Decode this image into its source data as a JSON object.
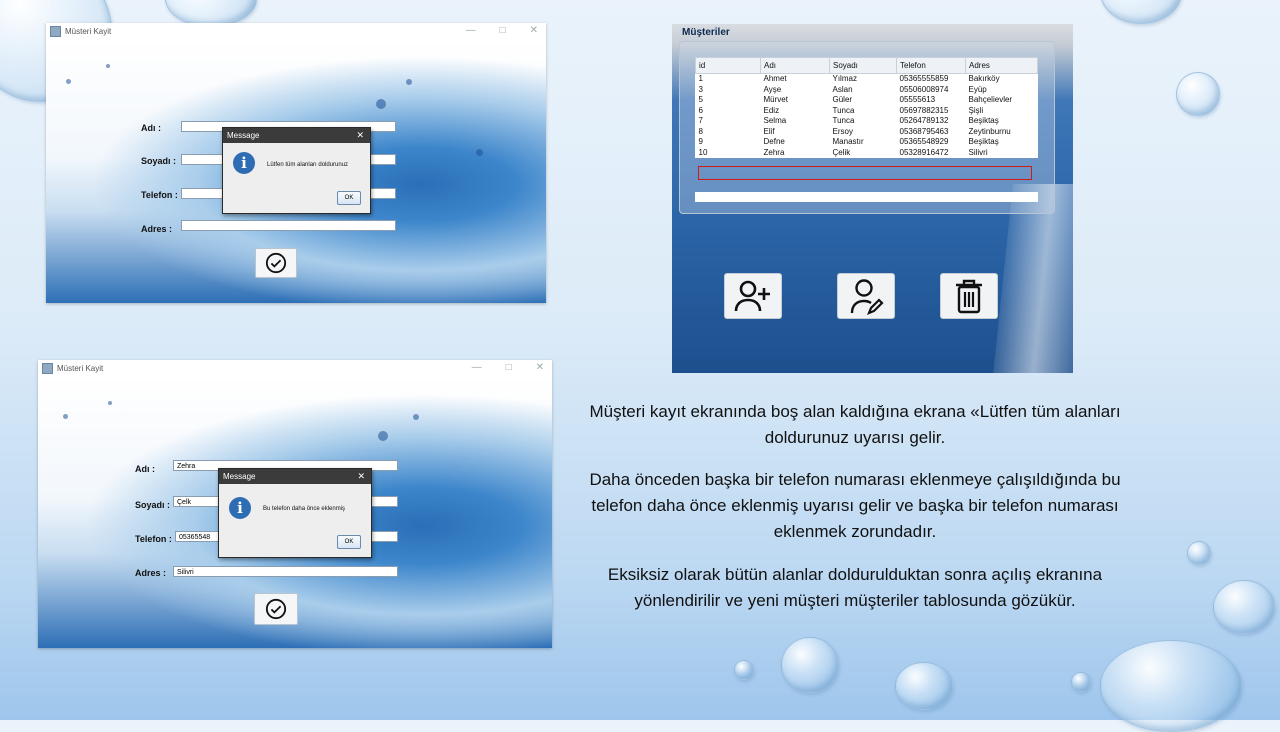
{
  "window1": {
    "title": "Müsteri Kayit",
    "labels": {
      "ad": "Adı :",
      "soyad": "Soyadı :",
      "telefon": "Telefon :",
      "adres": "Adres :"
    },
    "fields": {
      "ad": "",
      "soyad": "",
      "telefon": "",
      "adres": ""
    },
    "dialog": {
      "title": "Message",
      "message": "Lütfen tüm alanları doldurunuz",
      "ok": "OK"
    }
  },
  "window2": {
    "title": "Müsteri Kayit",
    "labels": {
      "ad": "Adı :",
      "soyad": "Soyadı :",
      "telefon": "Telefon :",
      "adres": "Adres :"
    },
    "fields": {
      "ad": "Zehra",
      "soyad": "Çelk",
      "telefon": "05365548",
      "adres": "Silivri"
    },
    "dialog": {
      "title": "Message",
      "message": "Bu telefon daha önce eklenmiş",
      "ok": "OK"
    }
  },
  "customers": {
    "title": "Müşteriler",
    "columns": [
      "id",
      "Adı",
      "Soyadı",
      "Telefon",
      "Adres"
    ],
    "rows": [
      [
        "1",
        "Ahmet",
        "Yılmaz",
        "05365555859",
        "Bakırköy"
      ],
      [
        "3",
        "Ayşe",
        "Aslan",
        "05506008974",
        "Eyüp"
      ],
      [
        "5",
        "Mürvet",
        "Güler",
        "05555613",
        "Bahçelievler"
      ],
      [
        "6",
        "Ediz",
        "Tunca",
        "05697882315",
        "Şişli"
      ],
      [
        "7",
        "Selma",
        "Tunca",
        "05264789132",
        "Beşiktaş"
      ],
      [
        "8",
        "Elif",
        "Ersoy",
        "05368795463",
        "Zeytinburnu"
      ],
      [
        "9",
        "Defne",
        "Manastır",
        "05365548929",
        "Beşiktaş"
      ],
      [
        "10",
        "Zehra",
        "Çelik",
        "05328916472",
        "Silivri"
      ]
    ],
    "buttons": [
      "add-user-icon",
      "edit-user-icon",
      "trash-icon"
    ]
  },
  "text": {
    "p1": "Müşteri kayıt ekranında boş alan kaldığına ekrana «Lütfen tüm alanları doldurunuz uyarısı gelir.",
    "p2": "Daha önceden başka bir telefon numarası eklenmeye çalışıldığında bu telefon daha önce eklenmiş uyarısı gelir ve başka bir telefon numarası eklenmek zorundadır.",
    "p3": "Eksiksiz olarak bütün alanlar doldurulduktan sonra açılış ekranına yönlendirilir ve yeni müşteri müşteriler tablosunda gözükür."
  },
  "colors": {
    "highlight": "#d11b1b",
    "dialog_title": "#3b3b3b",
    "info_icon": "#2e6db4"
  }
}
